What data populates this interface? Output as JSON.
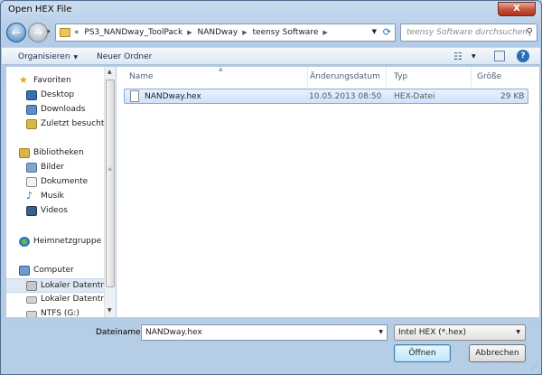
{
  "window": {
    "title": "Open HEX File",
    "close": "X"
  },
  "nav": {
    "back": "←",
    "forward": "→",
    "history": "▾",
    "breadcrumb": [
      "«",
      "PS3_NANDway_ToolPack",
      "NANDway",
      "teensy Software"
    ],
    "search_placeholder": "teensy Software durchsuchen"
  },
  "toolbar": {
    "organize": "Organisieren",
    "new_folder": "Neuer Ordner",
    "help": "?"
  },
  "sidebar": {
    "favorites": {
      "label": "Favoriten",
      "items": [
        "Desktop",
        "Downloads",
        "Zuletzt besucht"
      ]
    },
    "libraries": {
      "label": "Bibliotheken",
      "items": [
        "Bilder",
        "Dokumente",
        "Musik",
        "Videos"
      ]
    },
    "homegroup": "Heimnetzgruppe",
    "computer": {
      "label": "Computer",
      "items": [
        "Lokaler Datenträg",
        "Lokaler Datenträg",
        "NTFS (G:)"
      ]
    }
  },
  "columns": {
    "name": "Name",
    "date": "Änderungsdatum",
    "type": "Typ",
    "size": "Größe"
  },
  "files": [
    {
      "name": "NANDway.hex",
      "date": "10.05.2013 08:50",
      "type": "HEX-Datei",
      "size": "29 KB"
    }
  ],
  "bottom": {
    "filename_label": "Dateiname:",
    "filename_value": "NANDway.hex",
    "filetype_value": "Intel HEX (*.hex)",
    "open": "Öffnen",
    "cancel": "Abbrechen"
  }
}
